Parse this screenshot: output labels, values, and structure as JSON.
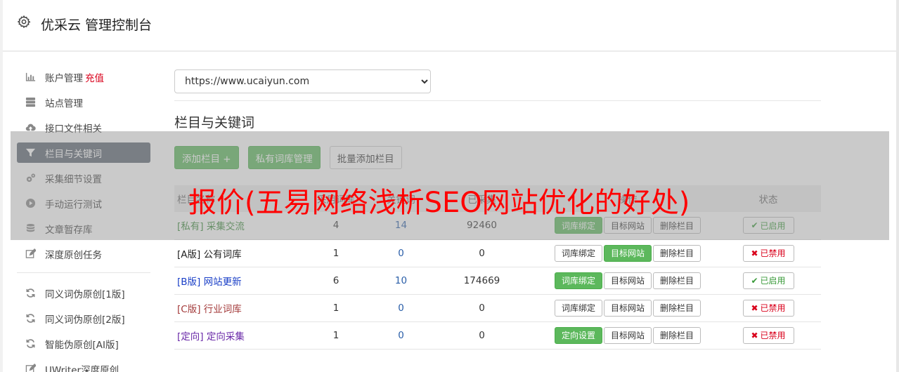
{
  "header": {
    "title": "优采云 管理控制台",
    "icon": "gear-icon"
  },
  "sidebar": {
    "items": [
      {
        "label": "账户管理",
        "extra": "充值",
        "icon": "bar-chart-icon"
      },
      {
        "label": "站点管理",
        "icon": "server-icon"
      },
      {
        "label": "接口文件相关",
        "icon": "cloud-upload-icon"
      },
      {
        "label": "栏目与关键词",
        "icon": "filter-icon",
        "active": true
      },
      {
        "label": "采集细节设置",
        "icon": "cogs-icon"
      },
      {
        "label": "手动运行测试",
        "icon": "play-circle-icon"
      },
      {
        "label": "文章暂存库",
        "icon": "database-icon"
      },
      {
        "label": "深度原创任务",
        "icon": "edit-icon"
      }
    ],
    "items2": [
      {
        "label": "同义词伪原创[1版]",
        "icon": "refresh-icon"
      },
      {
        "label": "同义词伪原创[2版]",
        "icon": "refresh-icon"
      },
      {
        "label": "智能伪原创[AI版]",
        "icon": "refresh-icon"
      },
      {
        "label": "UWriter深度原创",
        "icon": "edit-icon"
      }
    ]
  },
  "site_select": {
    "value": "https://www.ucaiyun.com"
  },
  "section": {
    "title": "栏目与关键词"
  },
  "toolbar": {
    "add_label": "添加栏目 +",
    "private_label": "私有词库管理",
    "batch_label": "批量添加栏目"
  },
  "table": {
    "headers": [
      "栏目名称",
      "采用词库",
      "关键词",
      "已采集",
      "操作",
      "状态"
    ],
    "rows": [
      {
        "prefix": "[私有]",
        "name": "采集交流",
        "a": "4",
        "b": "14",
        "c": "92460",
        "op1": "词库绑定",
        "op2": "目标网站",
        "op3": "删除栏目",
        "status": "已启用",
        "color": "c-private",
        "op1_green": true,
        "op2_green": false,
        "on": true
      },
      {
        "prefix": "[A版]",
        "name": "公有词库",
        "a": "1",
        "b": "0",
        "c": "0",
        "op1": "词库绑定",
        "op2": "目标网站",
        "op3": "删除栏目",
        "status": "已禁用",
        "color": "c-a",
        "op1_green": false,
        "op2_green": true,
        "on": false
      },
      {
        "prefix": "[B版]",
        "name": "网站更新",
        "a": "6",
        "b": "10",
        "c": "174669",
        "op1": "词库绑定",
        "op2": "目标网站",
        "op3": "删除栏目",
        "status": "已启用",
        "color": "c-b",
        "op1_green": true,
        "op2_green": false,
        "on": true
      },
      {
        "prefix": "[C版]",
        "name": "行业词库",
        "a": "1",
        "b": "0",
        "c": "0",
        "op1": "词库绑定",
        "op2": "目标网站",
        "op3": "删除栏目",
        "status": "已禁用",
        "color": "c-c",
        "op1_green": false,
        "op2_green": false,
        "on": false
      },
      {
        "prefix": "[定向]",
        "name": "定向采集",
        "a": "1",
        "b": "0",
        "c": "0",
        "op1": "定向设置",
        "op2": "目标网站",
        "op3": "删除栏目",
        "status": "已禁用",
        "color": "c-d",
        "op1_green": true,
        "op2_green": false,
        "on": false
      }
    ]
  },
  "watermark": {
    "text": "报价(五易网络浅析SEO网站优化的好处)"
  },
  "colors": {
    "accent": "#5cb85c",
    "active_nav": "#5c6773",
    "danger": "#d9001b"
  }
}
